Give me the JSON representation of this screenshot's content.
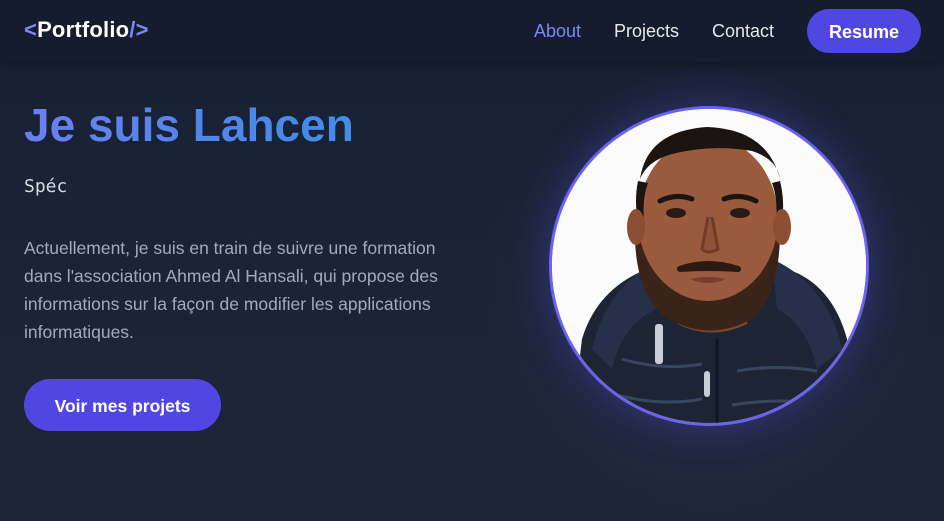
{
  "navbar": {
    "logo": {
      "open": "<",
      "text": "Portfolio",
      "close": "/>"
    },
    "links": [
      {
        "label": "About",
        "active": true
      },
      {
        "label": "Projects",
        "active": false
      },
      {
        "label": "Contact",
        "active": false
      }
    ],
    "resume_label": "Resume"
  },
  "hero": {
    "title": "Je suis Lahcen",
    "subtitle": "Spéc",
    "description": "Actuellement, je suis en train de suivre une formation dans l'association Ahmed Al Hansali, qui propose des informations sur la façon de modifier les applications informatiques.",
    "cta_label": "Voir mes projets"
  },
  "colors": {
    "accent": "#5047e3",
    "active_link": "#7f86f5",
    "background": "#1a2234",
    "navbar": "#141c2d",
    "portrait_border": "#6a63f0"
  }
}
